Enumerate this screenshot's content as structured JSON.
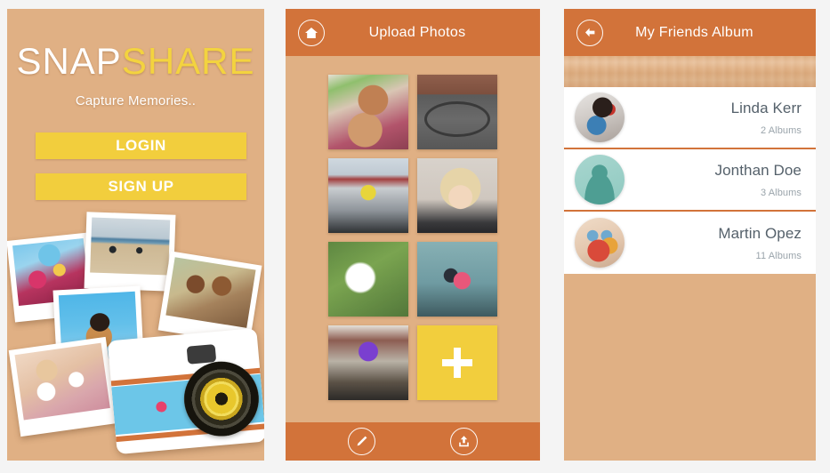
{
  "theme": {
    "orange": "#d2733a",
    "yellow": "#f2ce3d",
    "wood": "#dfae80",
    "page_bg": "#f4f4f4",
    "text_slate": "#55616b",
    "text_muted": "#9aa4ab"
  },
  "login_screen": {
    "logo_part_one": "SNAP",
    "logo_part_two": "SHARE",
    "tagline": "Capture Memories..",
    "login_label": "LOGIN",
    "signup_label": "SIGN UP",
    "collage": [
      {
        "name": "photo-coaster",
        "alt": "friends on roller coaster"
      },
      {
        "name": "photo-beach",
        "alt": "two people doing handstands on beach"
      },
      {
        "name": "photo-couple",
        "alt": "couple hugging outdoors"
      },
      {
        "name": "photo-shades",
        "alt": "man in sunglasses against blue sky"
      },
      {
        "name": "photo-icecream",
        "alt": "two women with ice cream"
      }
    ],
    "camera_graphic": "retro camera illustration"
  },
  "upload_screen": {
    "title": "Upload Photos",
    "home_icon": "home-icon",
    "photos": [
      {
        "name": "photo-rabbits",
        "alt": "two brown rabbits"
      },
      {
        "name": "photo-bicycle",
        "alt": "bicycle on pavement"
      },
      {
        "name": "photo-man-sitting",
        "alt": "man in yellow shirt sitting"
      },
      {
        "name": "photo-marilyn",
        "alt": "blonde woman portrait"
      },
      {
        "name": "photo-dandelion",
        "alt": "dandelion seed head"
      },
      {
        "name": "photo-couple",
        "alt": "couple in traditional dress"
      },
      {
        "name": "photo-hall",
        "alt": "event hall with stage"
      }
    ],
    "add_label": "+",
    "edit_icon": "pencil-icon",
    "upload_icon": "upload-icon"
  },
  "album_screen": {
    "title": "My Friends Album",
    "back_icon": "back-arrow-icon",
    "friends": [
      {
        "name": "Linda Kerr",
        "albums": "2 Albums",
        "avatar": "avatar-linda"
      },
      {
        "name": "Jonthan Doe",
        "albums": "3 Albums",
        "avatar": "avatar-jonthan"
      },
      {
        "name": "Martin Opez",
        "albums": "11 Albums",
        "avatar": "avatar-martin"
      }
    ]
  }
}
